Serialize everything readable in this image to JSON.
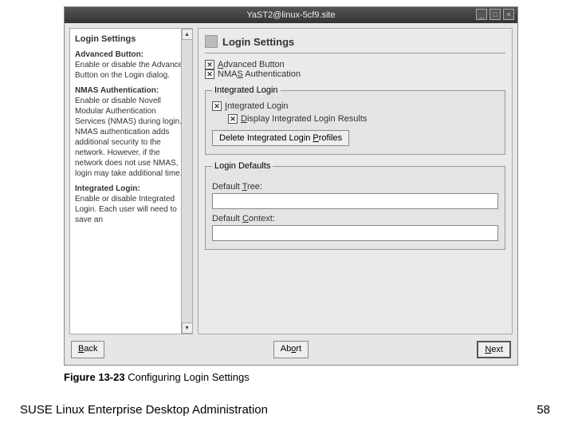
{
  "window": {
    "title": "YaST2@linux-5cf9.site",
    "btn_min": "_",
    "btn_max": "□",
    "btn_close": "×"
  },
  "help": {
    "title": "Login Settings",
    "sections": [
      {
        "heading": "Advanced Button:",
        "body": "Enable or disable the Advanced Button on the Login dialog."
      },
      {
        "heading": "NMAS Authentication:",
        "body": "Enable or disable Novell Modular Authentication Services (NMAS) during login. NMAS authentication adds additional security to the network. However, if the network does not use NMAS, login may take additional time."
      },
      {
        "heading": "Integrated Login:",
        "body": "Enable or disable Integrated Login. Each user will need to save an"
      }
    ],
    "scroll_up": "▴",
    "scroll_down": "▾"
  },
  "main": {
    "heading": "Login Settings",
    "check_advanced": "Advanced Button",
    "check_nmas": "NMAS Authentication",
    "group_integrated": {
      "legend": "Integrated Login",
      "check_integrated": "Integrated Login",
      "check_display_results": "Display Integrated Login Results",
      "btn_delete_profiles": "Delete Integrated Login Profiles"
    },
    "group_defaults": {
      "legend": "Login Defaults",
      "label_tree": "Default Tree:",
      "value_tree": "",
      "label_context": "Default Context:",
      "value_context": ""
    }
  },
  "buttons": {
    "back": "Back",
    "abort": "Abort",
    "next": "Next"
  },
  "caption": {
    "figure_label": "Figure 13-23",
    "figure_text": " Configuring Login Settings"
  },
  "footer": {
    "title": "SUSE Linux Enterprise Desktop Administration",
    "page": "58"
  },
  "checkmark": "✕"
}
